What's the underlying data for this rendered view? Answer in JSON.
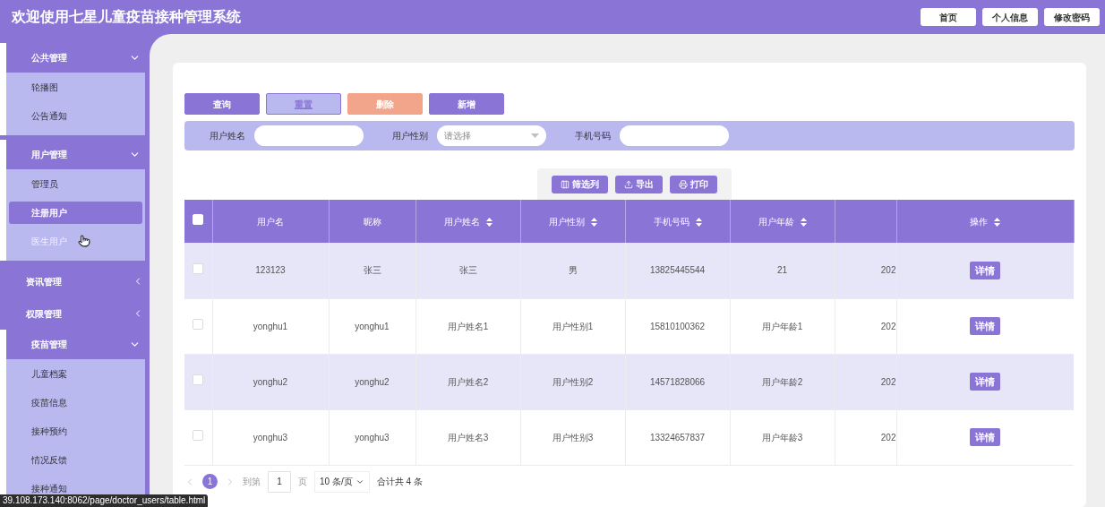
{
  "header": {
    "title": "欢迎使用七星儿童疫苗接种管理系统",
    "nav_buttons": [
      "首页",
      "个人信息",
      "修改密码"
    ]
  },
  "sidebar": {
    "groups": [
      {
        "label": "公共管理",
        "expanded": true,
        "children": [
          {
            "label": "轮播图",
            "selected": false,
            "hovered": false
          },
          {
            "label": "公告通知",
            "selected": false,
            "hovered": false
          }
        ]
      },
      {
        "label": "用户管理",
        "expanded": true,
        "children": [
          {
            "label": "管理员",
            "selected": false,
            "hovered": false
          },
          {
            "label": "注册用户",
            "selected": true,
            "hovered": false
          },
          {
            "label": "医生用户",
            "selected": false,
            "hovered": true
          }
        ]
      },
      {
        "label": "资讯管理",
        "expanded": false
      },
      {
        "label": "权限管理",
        "expanded": false
      },
      {
        "label": "疫苗管理",
        "expanded": true,
        "children": [
          {
            "label": "儿童档案",
            "selected": false,
            "hovered": false
          },
          {
            "label": "疫苗信息",
            "selected": false,
            "hovered": false
          },
          {
            "label": "接种预约",
            "selected": false,
            "hovered": false
          },
          {
            "label": "情况反馈",
            "selected": false,
            "hovered": false
          },
          {
            "label": "接种通知",
            "selected": false,
            "hovered": false
          }
        ]
      }
    ]
  },
  "actions": [
    {
      "label": "查询",
      "kind": "primary"
    },
    {
      "label": "重置",
      "kind": "secondary"
    },
    {
      "label": "删除",
      "kind": "danger"
    },
    {
      "label": "新增",
      "kind": "primary"
    }
  ],
  "filters": [
    {
      "kind": "text",
      "label": "用户姓名"
    },
    {
      "kind": "select",
      "label": "用户性别",
      "placeholder": "请选择"
    },
    {
      "kind": "text",
      "label": "手机号码"
    }
  ],
  "table_tools": [
    "筛选列",
    "导出",
    "打印"
  ],
  "table": {
    "select_all_checked": false,
    "columns": [
      {
        "label": "用户名",
        "sortable": false
      },
      {
        "label": "昵称",
        "sortable": false
      },
      {
        "label": "用户姓名",
        "sortable": true
      },
      {
        "label": "用户性别",
        "sortable": true
      },
      {
        "label": "手机号码",
        "sortable": true
      },
      {
        "label": "用户年龄",
        "sortable": true
      },
      {
        "sortable": false
      },
      {
        "label": "操作",
        "sortable": true
      }
    ],
    "rows": [
      {
        "checked": false,
        "cells": [
          "123123",
          "张三",
          "张三",
          "男",
          "13825445544",
          "21",
          "202"
        ],
        "action": "详情"
      },
      {
        "checked": false,
        "cells": [
          "yonghu1",
          "yonghu1",
          "用户姓名1",
          "用户性别1",
          "15810100362",
          "用户年龄1",
          "202"
        ],
        "action": "详情"
      },
      {
        "checked": false,
        "cells": [
          "yonghu2",
          "yonghu2",
          "用户姓名2",
          "用户性别2",
          "14571828066",
          "用户年龄2",
          "202"
        ],
        "action": "详情"
      },
      {
        "checked": false,
        "cells": [
          "yonghu3",
          "yonghu3",
          "用户姓名3",
          "用户性别3",
          "13324657837",
          "用户年龄3",
          "202"
        ],
        "action": "详情"
      }
    ]
  },
  "pagination": {
    "pages": [
      {
        "label": "1",
        "selected": true
      }
    ],
    "goto_label": "到第",
    "goto_value": "1",
    "page_unit": "页",
    "page_size": "10 条/页",
    "total": "合计共 4 条"
  },
  "status_bar": "39.108.173.140:8062/page/doctor_users/table.html"
}
